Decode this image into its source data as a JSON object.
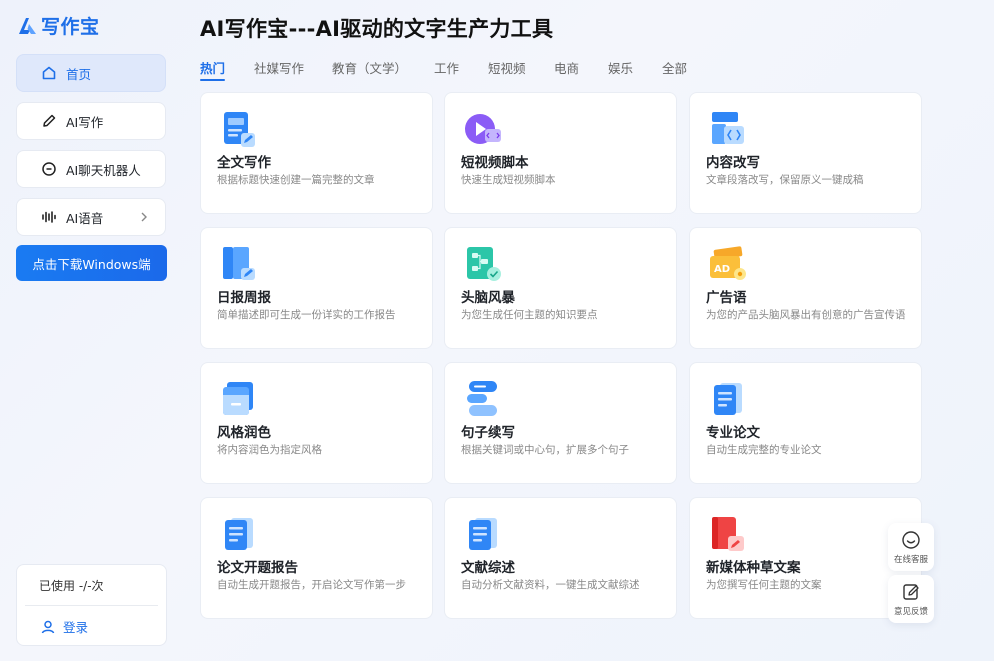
{
  "brand": {
    "name": "写作宝",
    "color": "#1e6fe8"
  },
  "sidebar": {
    "items": [
      {
        "label": "首页",
        "icon": "home-icon",
        "active": true
      },
      {
        "label": "AI写作",
        "icon": "pencil-icon"
      },
      {
        "label": "AI聊天机器人",
        "icon": "chat-icon"
      },
      {
        "label": "AI语音",
        "icon": "audio-wave-icon",
        "has_submenu": true
      }
    ],
    "download_label": "点击下载Windows端",
    "usage_text": "已使用 -/-次",
    "login_label": "登录"
  },
  "main": {
    "title": "AI写作宝---AI驱动的文字生产力工具",
    "tabs": [
      {
        "label": "热门",
        "active": true
      },
      {
        "label": "社媒写作"
      },
      {
        "label": "教育（文学）"
      },
      {
        "label": "工作"
      },
      {
        "label": "短视频"
      },
      {
        "label": "电商"
      },
      {
        "label": "娱乐"
      },
      {
        "label": "全部"
      }
    ],
    "cards": [
      {
        "title": "全文写作",
        "desc": "根据标题快速创建一篇完整的文章",
        "icon": "document-edit-icon"
      },
      {
        "title": "短视频脚本",
        "desc": "快速生成短视频脚本",
        "icon": "video-play-icon"
      },
      {
        "title": "内容改写",
        "desc": "文章段落改写，保留原义一键成稿",
        "icon": "code-block-icon"
      },
      {
        "title": "日报周报",
        "desc": "简单描述即可生成一份详实的工作报告",
        "icon": "report-book-icon"
      },
      {
        "title": "头脑风暴",
        "desc": "为您生成任何主题的知识要点",
        "icon": "mind-map-icon"
      },
      {
        "title": "广告语",
        "desc": "为您的产品头脑风暴出有创意的广告宣传语",
        "icon": "ad-tag-icon"
      },
      {
        "title": "风格润色",
        "desc": "将内容润色为指定风格",
        "icon": "folder-style-icon"
      },
      {
        "title": "句子续写",
        "desc": "根据关键词或中心句，扩展多个句子",
        "icon": "text-lines-icon"
      },
      {
        "title": "专业论文",
        "desc": "自动生成完整的专业论文",
        "icon": "paper-document-icon"
      },
      {
        "title": "论文开题报告",
        "desc": "自动生成开题报告，开启论文写作第一步",
        "icon": "proposal-document-icon"
      },
      {
        "title": "文献综述",
        "desc": "自动分析文献资料，一键生成文献综述",
        "icon": "literature-document-icon"
      },
      {
        "title": "新媒体种草文案",
        "desc": "为您撰写任何主题的文案",
        "icon": "red-book-icon"
      }
    ]
  },
  "floating": {
    "service_label": "在线客服",
    "feedback_label": "意见反馈"
  }
}
